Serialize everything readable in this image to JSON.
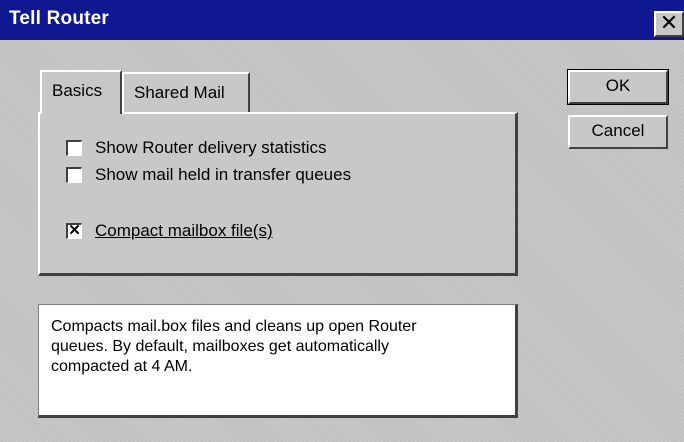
{
  "window": {
    "title": "Tell Router",
    "close_glyph": "✕"
  },
  "tabs": [
    {
      "label": "Basics",
      "active": true
    },
    {
      "label": "Shared Mail",
      "active": false
    }
  ],
  "options": [
    {
      "label": "Show Router delivery statistics",
      "checked": false
    },
    {
      "label": "Show mail held in transfer queues",
      "checked": false
    },
    {
      "label": "Compact mailbox file(s)",
      "checked": true,
      "check_glyph": "✕"
    }
  ],
  "buttons": {
    "ok": "OK",
    "cancel": "Cancel"
  },
  "description": {
    "line1": "Compacts mail.box files and cleans up open Router",
    "line2": "queues. By default, mailboxes get automatically",
    "line3": "compacted at 4 AM."
  },
  "colors": {
    "titlebar": "#0f1890",
    "face": "#c8c8c8"
  }
}
